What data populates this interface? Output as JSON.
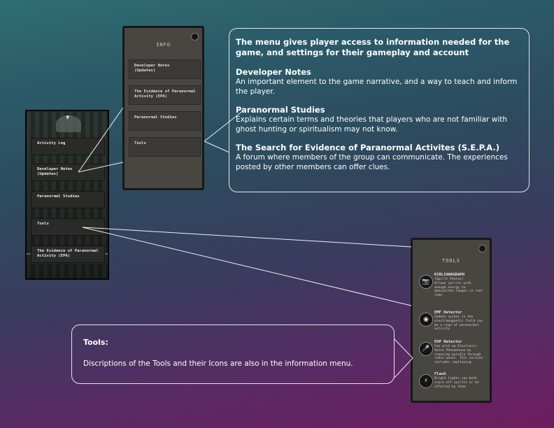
{
  "game_menu": {
    "items": [
      {
        "label": "Activity Log"
      },
      {
        "label": "Developer Notes\n(Updates)"
      },
      {
        "label": "Paranormal Studies"
      },
      {
        "label": "Tools"
      },
      {
        "label": "The Evidence of Paranormal\nActivity (EPA)"
      }
    ]
  },
  "info_screen": {
    "title": "INFO",
    "items": [
      {
        "label": "Developer Notes\n(Updates)"
      },
      {
        "label": "The Evidence of Paranormal\nActivity (EPA)"
      },
      {
        "label": "Paranormal Studies"
      },
      {
        "label": "Tools"
      }
    ]
  },
  "tools_screen": {
    "title": "TOOLS",
    "tools": [
      {
        "name": "KIRLIANOGRAPH",
        "icon": "camera-icon",
        "glyph": "📷",
        "desc": "(Spirit Photos)\nAllows spirits with\nenough energy to\nmanipulate images in real\ntime"
      },
      {
        "name": "EMF Detector",
        "icon": "emf-detector-icon",
        "glyph": "◉",
        "desc": "Sudden spikes in the\nelectromagnetic field can\nbe a sign of paranormal\nactivity"
      },
      {
        "name": "EVP Detector",
        "icon": "microphone-icon",
        "glyph": "🎤",
        "desc": "Can pick up Electronic\nVoice Phenomenon by\nscanning quickly through\nradio waves. This version\nincludes captioning."
      },
      {
        "name": "Flash",
        "icon": "lightning-icon",
        "glyph": "⚡",
        "desc": "Bright lights can both\nscare off spirits or be\naffected by them."
      }
    ]
  },
  "callout_menu": {
    "intro": "The menu gives player access to information needed for the game, and settings for their gameplay and account",
    "sections": [
      {
        "heading": "Developer Notes",
        "text": "An important element to the game narrative, and a way to teach and inform the player."
      },
      {
        "heading": "Paranormal Studies",
        "text": "Explains certain terms and theories that players who are not familiar with ghost hunting or spiritualism may not know."
      },
      {
        "heading": "The Search  for Evidence of Paranormal Activites (S.E.P.A.)",
        "text": "A forum where members of the group can communicate.  The experiences posted by other members can offer clues."
      }
    ]
  },
  "callout_tools": {
    "heading": "Tools:",
    "text": "Discriptions of the Tools and their Icons are also in the information menu."
  }
}
